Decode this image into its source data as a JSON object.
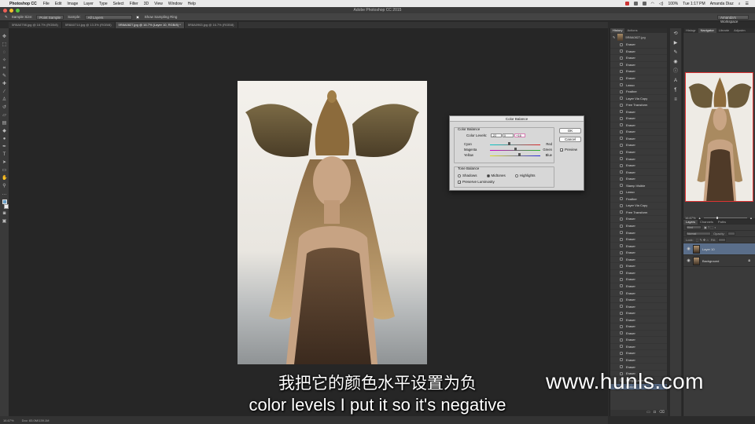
{
  "menubar": {
    "app": "Photoshop CC",
    "items": [
      "File",
      "Edit",
      "Image",
      "Layer",
      "Type",
      "Select",
      "Filter",
      "3D",
      "View",
      "Window",
      "Help"
    ],
    "battery": "100%",
    "clock": "Tue 1:17 PM",
    "user": "Amanda Diaz"
  },
  "window_title": "Adobe Photoshop CC 2015",
  "options": {
    "sample_size_label": "Sample Size:",
    "sample_size_value": "Point Sample",
    "sample_label": "Sample:",
    "sample_value": "All Layers",
    "show_ring": "Show Sampling Ring",
    "workspace": "Amanda's Workspace"
  },
  "tabs": [
    {
      "label": "5R8A0798.jpg @ 16.7% (RGB/8)",
      "active": false
    },
    {
      "label": "5R8A0714.jpg @ 13.3% (RGB/8)",
      "active": false
    },
    {
      "label": "5R8A0827.jpg @ 16.7% (Layer 10, RGB/8) *",
      "active": true
    },
    {
      "label": "5R8A0963.jpg @ 16.7% (RGB/8)",
      "active": false
    }
  ],
  "status": {
    "zoom": "16.67%",
    "doc": "Doc: 83.0M/139.1M"
  },
  "dialog": {
    "title": "Color Balance",
    "color_balance_label": "Color Balance",
    "color_levels_label": "Color Levels:",
    "levels": [
      "-22",
      "0",
      "+16"
    ],
    "sliders": [
      {
        "left": "Cyan",
        "right": "Red",
        "value": -22
      },
      {
        "left": "Magenta",
        "right": "Green",
        "value": 0
      },
      {
        "left": "Yellow",
        "right": "Blue",
        "value": 16
      }
    ],
    "tone_balance_label": "Tone Balance",
    "shadows": "Shadows",
    "midtones": "Midtones",
    "highlights": "Highlights",
    "preserve": "Preserve Luminosity",
    "ok": "OK",
    "cancel": "Cancel",
    "preview": "Preview"
  },
  "history": {
    "tabs": [
      "History",
      "Actions"
    ],
    "snapshot": "5R8A0827.jpg",
    "items": [
      "Eraser",
      "Eraser",
      "Eraser",
      "Eraser",
      "Eraser",
      "Eraser",
      "Lasso",
      "Feather",
      "Layer Via Copy",
      "Free Transform",
      "Eraser",
      "Eraser",
      "Eraser",
      "Eraser",
      "Eraser",
      "Eraser",
      "Eraser",
      "Eraser",
      "Eraser",
      "Eraser",
      "Eraser",
      "Stamp Visible",
      "Lasso",
      "Feather",
      "Layer Via Copy",
      "Free Transform",
      "Eraser",
      "Eraser",
      "Eraser",
      "Eraser",
      "Eraser",
      "Eraser",
      "Eraser",
      "Eraser",
      "Eraser",
      "Eraser",
      "Eraser",
      "Eraser",
      "Eraser",
      "Eraser",
      "Eraser",
      "Eraser",
      "Eraser",
      "Eraser",
      "Eraser",
      "Eraser",
      "Eraser",
      "Eraser",
      "Eraser",
      "Eraser",
      "Merge Layers",
      "Eraser"
    ]
  },
  "nav": {
    "tabs": [
      "Histogr",
      "Navigator",
      "Librarie",
      "Adjustm"
    ],
    "zoom": "16.67%"
  },
  "layers": {
    "tabs": [
      "Layers",
      "Channels",
      "Paths"
    ],
    "kind": "Kind",
    "blend": "Normal",
    "opacity_label": "Opacity:",
    "lock_label": "Lock:",
    "fill_label": "Fill:",
    "items": [
      {
        "name": "Layer 10",
        "selected": true,
        "locked": false
      },
      {
        "name": "Background",
        "selected": false,
        "locked": true
      }
    ]
  },
  "subtitles": {
    "cn": "我把它的颜色水平设置为负",
    "en": "color levels I put it so it's negative"
  },
  "watermark": "www.hunls.com"
}
